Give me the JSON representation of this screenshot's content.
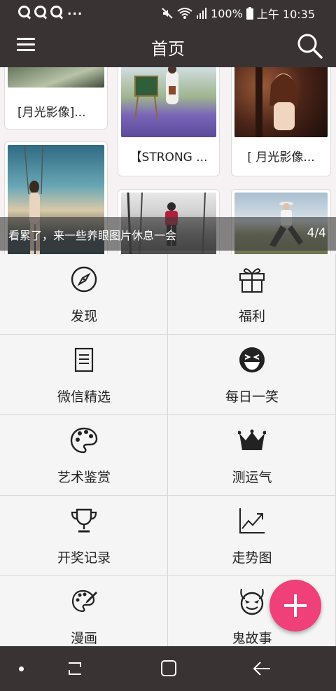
{
  "status_bar": {
    "notification_icons": [
      "q-icon",
      "q-icon",
      "q-icon"
    ],
    "overflow": "...",
    "battery": "100%",
    "time": "上午 10:35"
  },
  "app_bar": {
    "title": "首页"
  },
  "carousel": {
    "cards": [
      {
        "caption": "[月光影像]..."
      },
      {
        "caption": ""
      },
      {
        "caption": ""
      },
      {
        "caption": ""
      },
      {
        "caption": "【STRONG ..."
      },
      {
        "caption": "[ 月光影像..."
      },
      {
        "caption": ""
      },
      {
        "caption": ""
      }
    ],
    "overlay_text": "看累了，来一些养眼图片休息一会",
    "index": "4/4"
  },
  "grid": {
    "items": [
      {
        "label": "发现",
        "icon": "compass-icon"
      },
      {
        "label": "福利",
        "icon": "gift-icon"
      },
      {
        "label": "微信精选",
        "icon": "document-icon"
      },
      {
        "label": "每日一笑",
        "icon": "laugh-icon"
      },
      {
        "label": "艺术鉴赏",
        "icon": "palette-icon"
      },
      {
        "label": "测运气",
        "icon": "crown-icon"
      },
      {
        "label": "开奖记录",
        "icon": "trophy-icon"
      },
      {
        "label": "走势图",
        "icon": "trend-chart-icon"
      },
      {
        "label": "漫画",
        "icon": "brush-palette-icon"
      },
      {
        "label": "鬼故事",
        "icon": "devil-icon"
      }
    ]
  },
  "colors": {
    "bar": "#3a3334",
    "fab": "#f0407a",
    "grid_bg": "#f5f5f5"
  }
}
